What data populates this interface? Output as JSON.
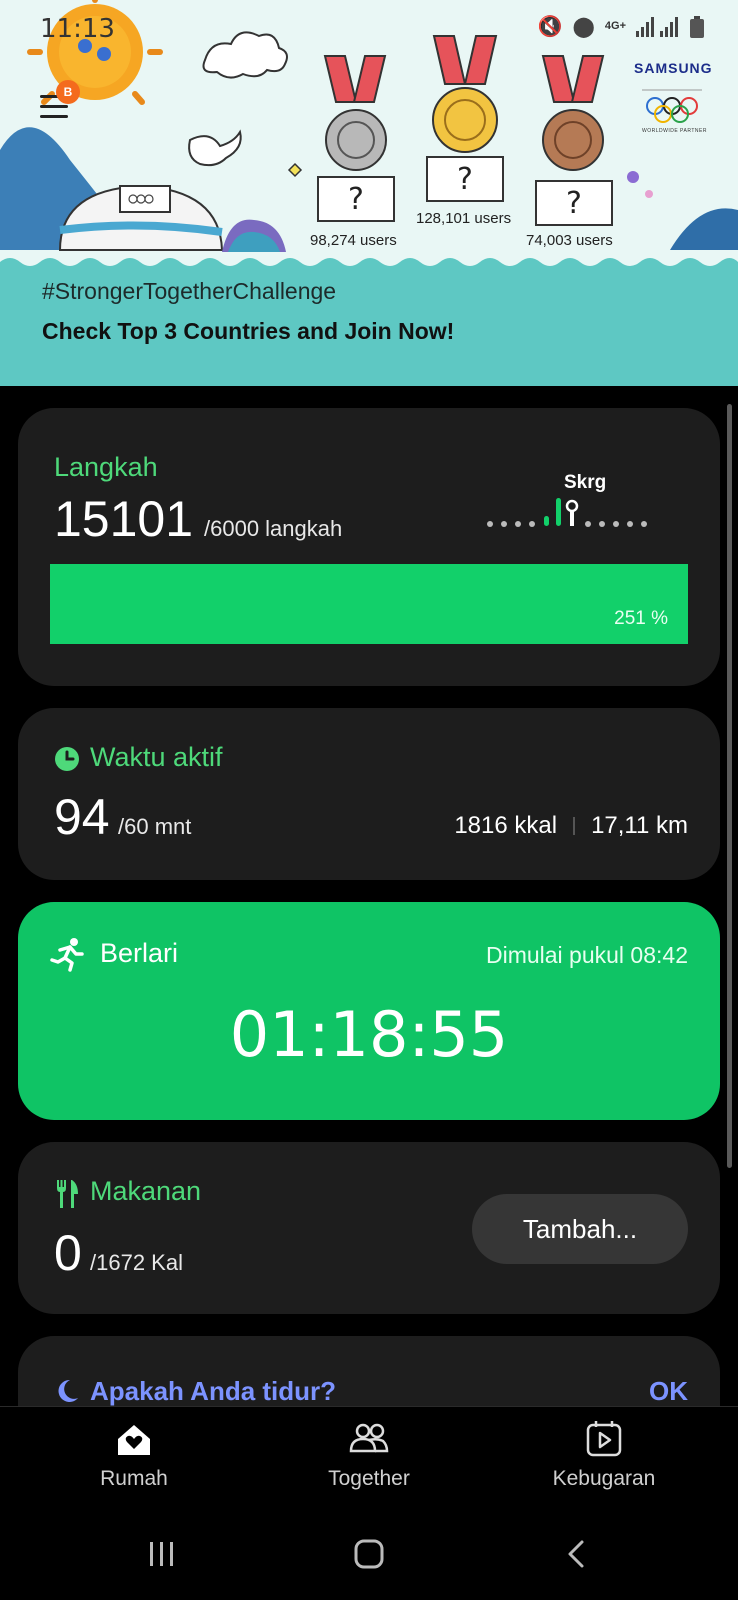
{
  "status_bar": {
    "time": "11:13",
    "network": "4G+"
  },
  "banner": {
    "menu_badge": "B",
    "medals": [
      {
        "rank": "2",
        "placeholder": "?",
        "users": "98,274 users",
        "color": "#b8b8b8"
      },
      {
        "rank": "1",
        "placeholder": "?",
        "users": "128,101 users",
        "color": "#e7b842"
      },
      {
        "rank": "3",
        "placeholder": "?",
        "users": "74,003 users",
        "color": "#b57a55"
      }
    ],
    "sponsor": "SAMSUNG",
    "sponsor_sub": "WORLDWIDE PARTNER",
    "hashtag": "#StrongerTogetherChallenge",
    "headline": "Check Top 3 Countries and Join Now!"
  },
  "steps": {
    "title": "Langkah",
    "value": "15101",
    "goal": "/6000 langkah",
    "percent_label": "251 %",
    "progress_fraction": 1.0,
    "now_label": "Skrg"
  },
  "active_time": {
    "title": "Waktu aktif",
    "value": "94",
    "goal": "/60 mnt",
    "calories": "1816 kkal",
    "distance": "17,11 km"
  },
  "running": {
    "title": "Berlari",
    "started": "Dimulai pukul 08:42",
    "timer": "01:18:55"
  },
  "food": {
    "title": "Makanan",
    "value": "0",
    "goal": "/1672 Kal",
    "add_label": "Tambah..."
  },
  "sleep": {
    "title": "Apakah Anda tidur?",
    "ok_label": "OK"
  },
  "bottom_nav": {
    "items": [
      {
        "label": "Rumah",
        "icon": "home-heart-icon"
      },
      {
        "label": "Together",
        "icon": "people-icon"
      },
      {
        "label": "Kebugaran",
        "icon": "fitness-video-icon"
      }
    ]
  },
  "colors": {
    "accent_green": "#12d06a",
    "run_green": "#0fc465",
    "sleep_blue": "#7c93ff",
    "card_bg": "#1d1d1d"
  }
}
